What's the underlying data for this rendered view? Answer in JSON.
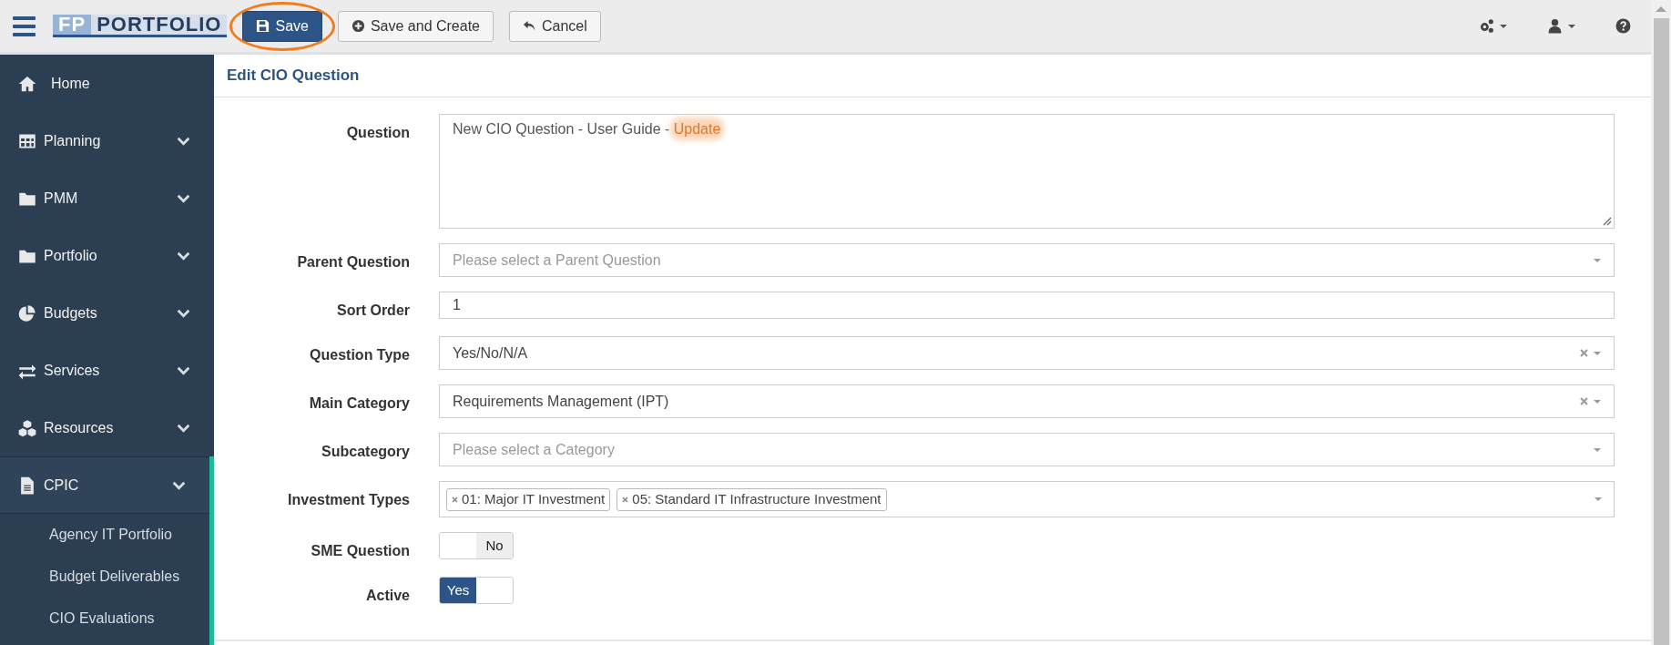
{
  "toolbar": {
    "logo": {
      "initials": "FP",
      "word": "PORTFOLIO"
    },
    "buttons": [
      {
        "kind": "save",
        "label": "Save",
        "circled": true
      },
      {
        "kind": "create",
        "label": "Save and Create",
        "circled": false
      },
      {
        "kind": "cancel",
        "label": "Cancel",
        "circled": false
      }
    ],
    "right_icons": [
      {
        "kind": "gears"
      },
      {
        "kind": "user"
      },
      {
        "kind": "help"
      }
    ]
  },
  "sidebar": {
    "items": [
      {
        "kind": "link",
        "label": "Home"
      },
      {
        "kind": "group",
        "label": "Planning",
        "expanded": false
      },
      {
        "kind": "group",
        "label": "PMM",
        "expanded": false
      },
      {
        "kind": "group",
        "label": "Portfolio",
        "expanded": false
      },
      {
        "kind": "group",
        "label": "Budgets",
        "expanded": false
      },
      {
        "kind": "group",
        "label": "Services",
        "expanded": false
      },
      {
        "kind": "group",
        "label": "Resources",
        "expanded": false
      },
      {
        "kind": "group",
        "label": "CPIC",
        "expanded": true,
        "children": [
          {
            "label": "Agency IT Portfolio"
          },
          {
            "label": "Budget Deliverables"
          },
          {
            "label": "CIO Evaluations"
          }
        ]
      }
    ]
  },
  "form": {
    "title": "Edit CIO Question",
    "fields": [
      {
        "kind": "textarea",
        "label": "Question",
        "value_parts": [
          {
            "text": "New CIO Question - User Guide - ",
            "highlighted": false
          },
          {
            "text": "Update",
            "highlighted": true
          }
        ]
      },
      {
        "kind": "select",
        "label": "Parent Question",
        "placeholder": "Please select a Parent Question",
        "clearable": false
      },
      {
        "kind": "text",
        "label": "Sort Order",
        "value": "1"
      },
      {
        "kind": "select",
        "label": "Question Type",
        "value": "Yes/No/N/A",
        "clearable": true
      },
      {
        "kind": "select",
        "label": "Main Category",
        "value": "Requirements Management (IPT)",
        "clearable": true
      },
      {
        "kind": "select",
        "label": "Subcategory",
        "placeholder": "Please select a Category",
        "clearable": false
      },
      {
        "kind": "multiselect",
        "label": "Investment Types",
        "tags": [
          "01: Major IT Investment",
          "05: Standard IT Infrastructure Investment"
        ]
      },
      {
        "kind": "toggle",
        "label": "SME Question",
        "on": false,
        "state_text": "No"
      },
      {
        "kind": "toggle",
        "label": "Active",
        "on": true,
        "state_text": "Yes"
      }
    ]
  }
}
